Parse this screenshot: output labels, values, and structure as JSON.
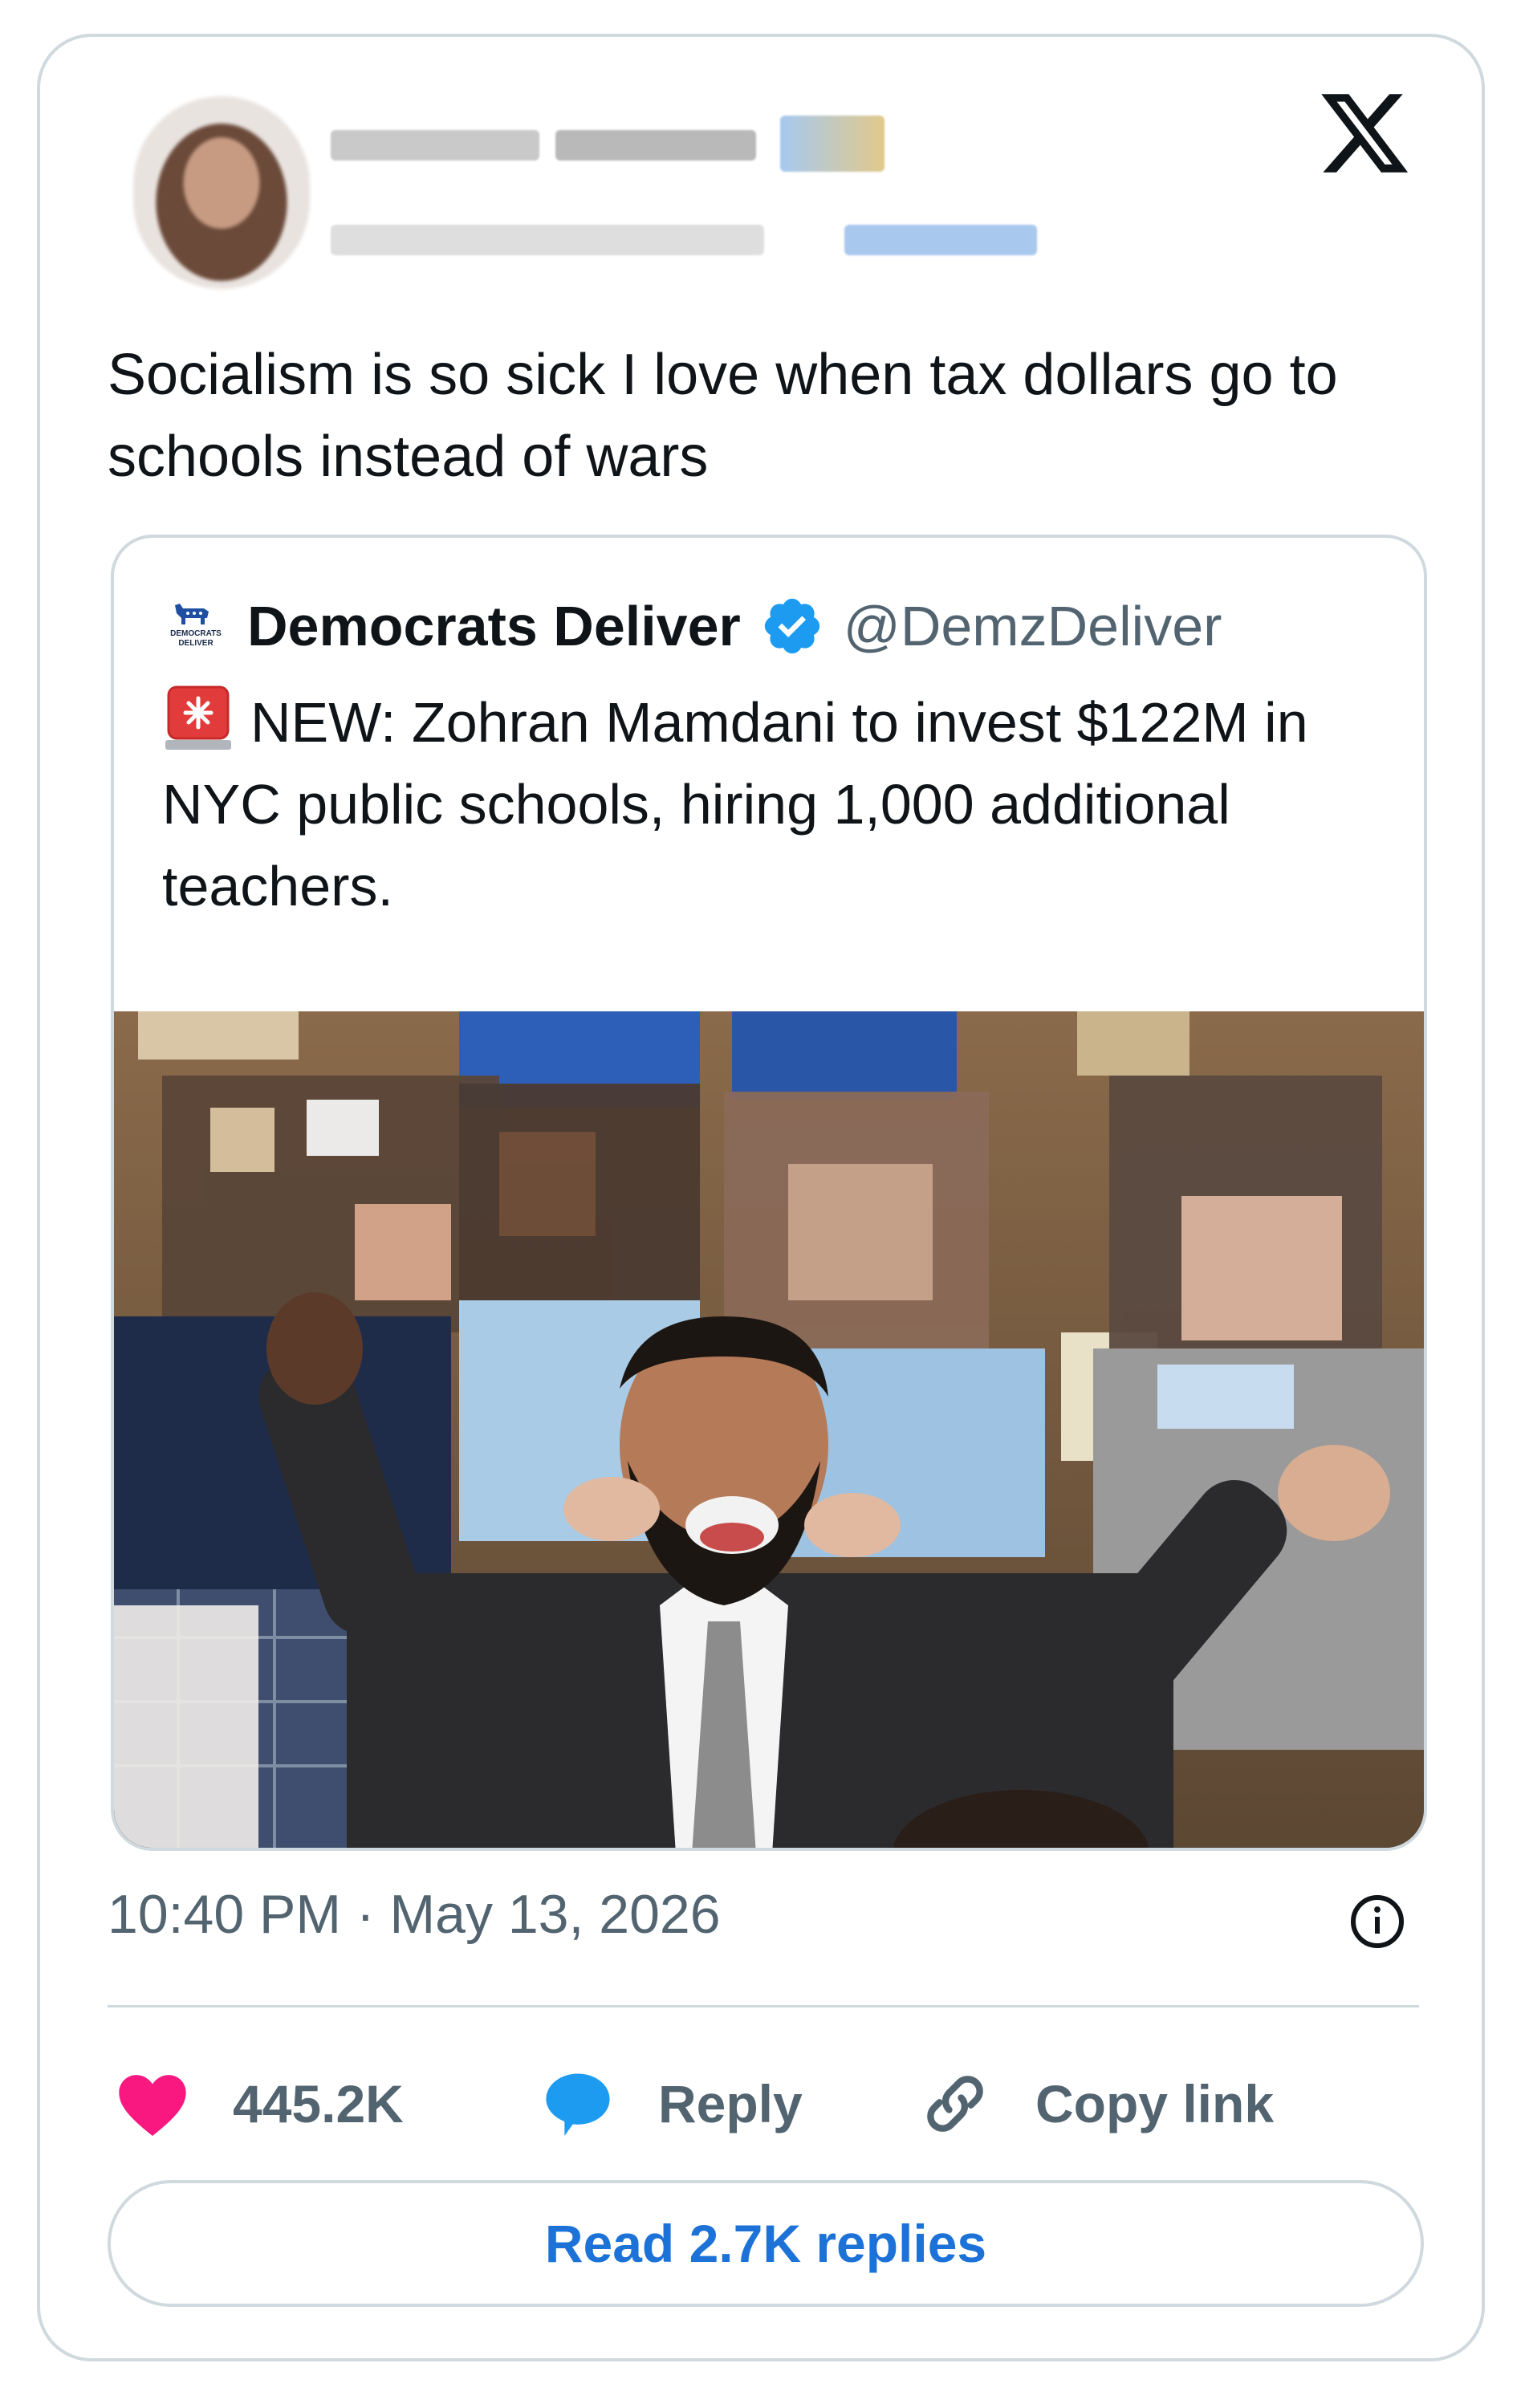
{
  "tweet": {
    "text": "Socialism is so sick I love when tax dollars go to\nschools instead of wars",
    "timestamp": "10:40 PM · May 13, 2026"
  },
  "quoted": {
    "name": "Democrats Deliver",
    "handle": "@DemzDeliver",
    "logo_text": "DEMOCRATS DELIVER",
    "text": "NEW: Zohran Mamdani to invest $122M in NYC public schools, hiring 1,000 additional teachers."
  },
  "actions": {
    "likes": "445.2K",
    "reply": "Reply",
    "copy_link": "Copy link",
    "read_replies": "Read 2.7K replies"
  },
  "colors": {
    "like": "#f91880",
    "reply_bubble": "#1d9bf0",
    "verified": "#1d9bf0",
    "link": "#1d72d8",
    "border": "#cfd9de",
    "muted": "#536471"
  },
  "icons": [
    "x-logo-icon",
    "verified-badge-icon",
    "siren-icon",
    "info-icon",
    "heart-icon",
    "reply-bubble-icon",
    "link-icon"
  ]
}
